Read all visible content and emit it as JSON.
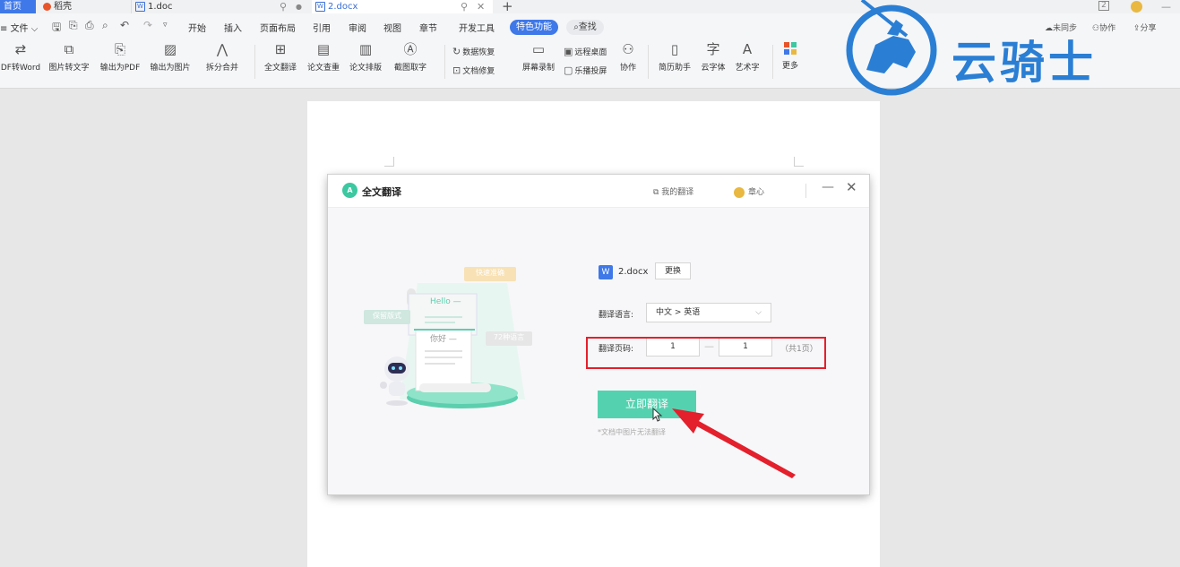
{
  "tabs": {
    "home": "首页",
    "docer": "稻壳",
    "doc1": "1.doc",
    "doc2": "2.docx",
    "doc_icon_letter": "W",
    "new_tab": "+"
  },
  "menu": {
    "file": "文件",
    "items": [
      "开始",
      "插入",
      "页面布局",
      "引用",
      "审阅",
      "视图",
      "章节",
      "开发工具"
    ],
    "special": "特色功能",
    "search": "查找",
    "sync": "未同步",
    "collab": "协作",
    "share": "分享"
  },
  "ribbon": {
    "pdf_to_word": "DF转Word",
    "img_to_text": "图片转文字",
    "export_pdf": "输出为PDF",
    "export_img": "输出为图片",
    "split_merge": "拆分合并",
    "full_translate": "全文翻译",
    "paper_check": "论文查重",
    "paper_layout": "论文排版",
    "screenshot_ocr": "截图取字",
    "data_recover": "数据恢复",
    "doc_repair": "文档修复",
    "screen_record": "屏幕录制",
    "remote_desktop": "远程桌面",
    "cast_screen": "乐播投屏",
    "collaborate": "协作",
    "resume": "简历助手",
    "cloud_font": "云字体",
    "art_text": "艺术字",
    "more": "更多"
  },
  "watermark": {
    "text": "云骑士"
  },
  "dialog": {
    "title": "全文翻译",
    "logo_text": "A",
    "my_translations": "我的翻译",
    "user": "章心",
    "file_letter": "W",
    "file_name": "2.docx",
    "change": "更换",
    "lang_label": "翻译语言:",
    "lang_value": "中文 > 英语",
    "pages_label": "翻译页码:",
    "page_from": "1",
    "page_to": "1",
    "page_dash": "—",
    "page_total": "（共1页）",
    "translate_btn": "立即翻译",
    "note": "*文档中图片无法翻译",
    "ill_fast": "快速准确",
    "ill_keep": "保留版式",
    "ill_langs": "72种语言",
    "ill_hello": "Hello —",
    "ill_nihao": "你好 —"
  },
  "colors": {
    "accent": "#3f78e8",
    "translate_button": "#54d2b0",
    "highlight": "#e3202c",
    "watermark": "#2a7fd4"
  }
}
